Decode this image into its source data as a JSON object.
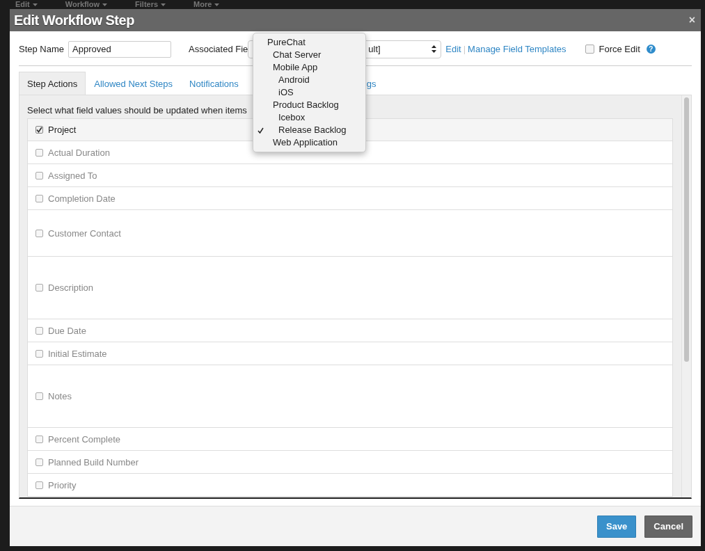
{
  "backdrop": {
    "menu": [
      "Edit",
      "Workflow",
      "Filters",
      "More"
    ]
  },
  "dialog": {
    "title": "Edit Workflow Step",
    "close": "×"
  },
  "form": {
    "step_name_label": "Step Name",
    "step_name_value": "Approved",
    "associated_label": "Associated Fie",
    "associated_value": "ult]",
    "edit_link": "Edit",
    "separator": "|",
    "manage_link": "Manage Field Templates",
    "force_edit_label": "Force Edit",
    "force_edit_checked": false,
    "help": "?"
  },
  "tabs": [
    {
      "label": "Step Actions",
      "selected": true
    },
    {
      "label": "Allowed Next Steps",
      "selected": false
    },
    {
      "label": "Notifications",
      "selected": false
    },
    {
      "label": "gs",
      "selected": false
    }
  ],
  "instruction": "Select what field values should be updated when items",
  "fields": [
    {
      "label": "Project",
      "checked": true,
      "kind": "line"
    },
    {
      "label": "Actual Duration",
      "checked": false,
      "kind": "line"
    },
    {
      "label": "Assigned To",
      "checked": false,
      "kind": "line"
    },
    {
      "label": "Completion Date",
      "checked": false,
      "kind": "line"
    },
    {
      "label": "Customer Contact",
      "checked": false,
      "kind": "multi"
    },
    {
      "label": "Description",
      "checked": false,
      "kind": "rich"
    },
    {
      "label": "Due Date",
      "checked": false,
      "kind": "line"
    },
    {
      "label": "Initial Estimate",
      "checked": false,
      "kind": "line"
    },
    {
      "label": "Notes",
      "checked": false,
      "kind": "rich"
    },
    {
      "label": "Percent Complete",
      "checked": false,
      "kind": "line"
    },
    {
      "label": "Planned Build Number",
      "checked": false,
      "kind": "line"
    },
    {
      "label": "Priority",
      "checked": false,
      "kind": "line"
    }
  ],
  "dropdown": {
    "items": [
      {
        "label": "PureChat",
        "selected": false,
        "children": [
          {
            "label": "Chat Server",
            "selected": false
          },
          {
            "label": "Mobile App",
            "selected": false,
            "children": [
              {
                "label": "Android",
                "selected": false
              },
              {
                "label": "iOS",
                "selected": false
              }
            ]
          },
          {
            "label": "Product Backlog",
            "selected": false,
            "children": [
              {
                "label": "Icebox",
                "selected": false
              },
              {
                "label": "Release Backlog",
                "selected": true
              }
            ]
          },
          {
            "label": "Web Application",
            "selected": false
          }
        ]
      }
    ]
  },
  "buttons": [
    {
      "label": "Save",
      "kind": "primary"
    },
    {
      "label": "Cancel",
      "kind": "secondary"
    }
  ]
}
